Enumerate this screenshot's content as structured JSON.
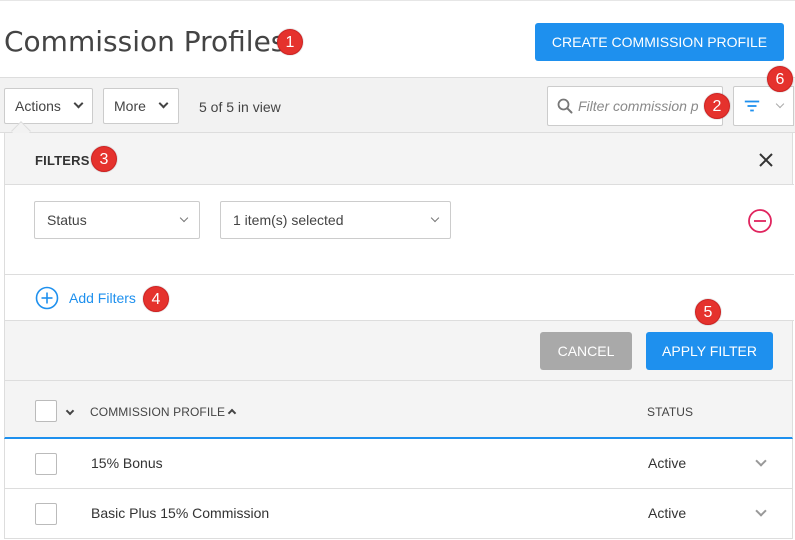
{
  "header": {
    "title": "Commission Profiles",
    "create_button": "CREATE COMMISSION PROFILE"
  },
  "toolbar": {
    "actions_label": "Actions",
    "more_label": "More",
    "count_text": "5 of 5 in view",
    "search_placeholder": "Filter commission p"
  },
  "filters": {
    "title": "FILTERS",
    "rows": [
      {
        "field": "Status",
        "value": "1 item(s) selected"
      }
    ],
    "add_label": "Add Filters",
    "cancel_label": "CANCEL",
    "apply_label": "APPLY FILTER"
  },
  "table": {
    "columns": [
      "COMMISSION PROFILE",
      "STATUS"
    ],
    "rows": [
      {
        "name": "15% Bonus",
        "status": "Active"
      },
      {
        "name": "Basic Plus 15% Commission",
        "status": "Active"
      }
    ]
  },
  "badges": [
    "1",
    "2",
    "3",
    "4",
    "5",
    "6"
  ],
  "colors": {
    "primary": "#1e90ee",
    "badge": "#e5322d",
    "remove": "#e0245e",
    "cancel": "#a9a9a9"
  },
  "icons": [
    "search-icon",
    "filter-icon",
    "chevron-down-icon",
    "close-icon",
    "remove-circle-icon",
    "add-circle-icon",
    "sort-up-icon"
  ]
}
